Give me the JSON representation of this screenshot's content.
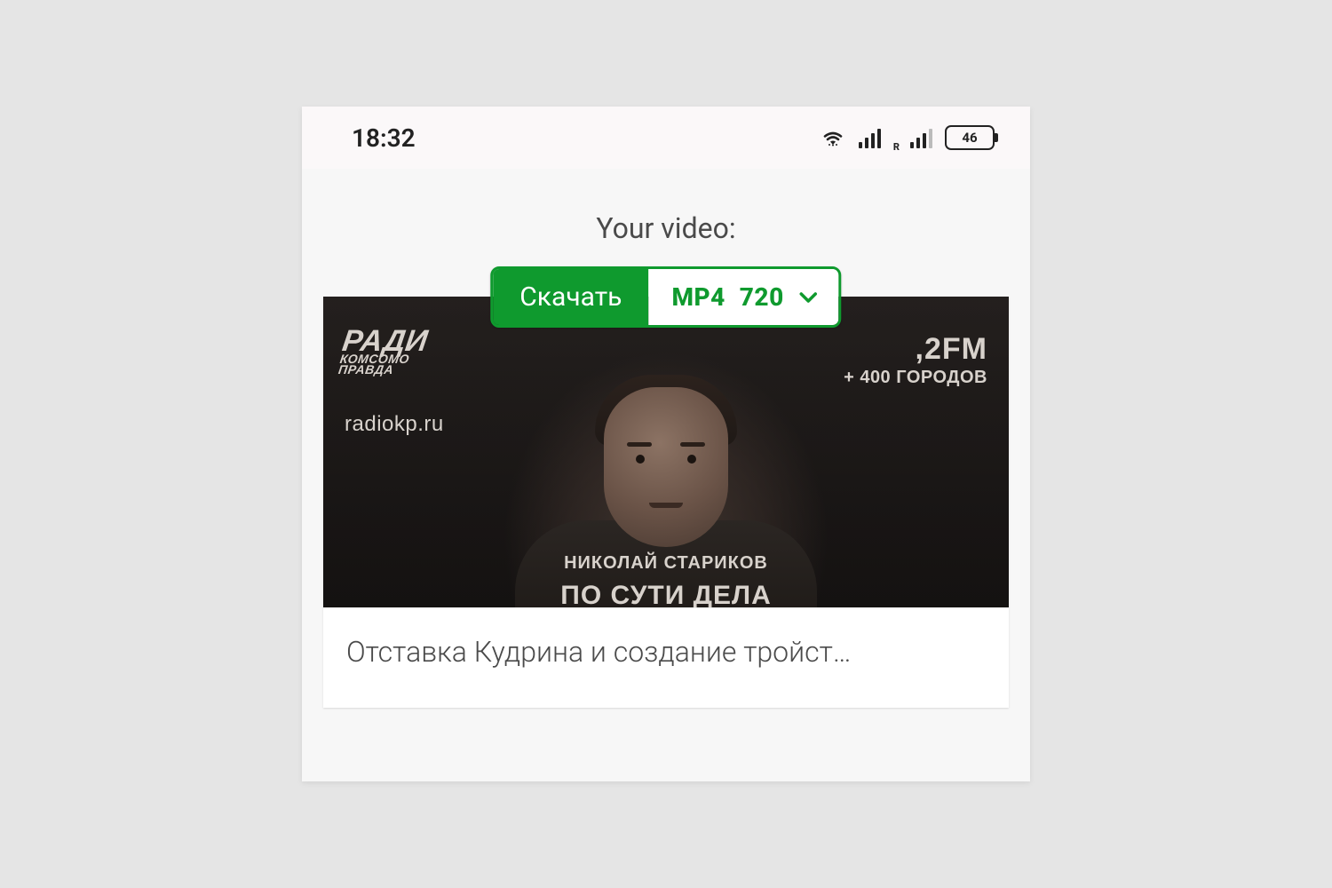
{
  "status": {
    "time": "18:32",
    "battery_pct": "46"
  },
  "heading": "Your video:",
  "download": {
    "button_label": "Скачать",
    "format": "MP4",
    "quality": "720"
  },
  "thumb": {
    "brand_line1": "РАДИ",
    "brand_line2": "КОМСОМО",
    "brand_line3": "ПРАВДА",
    "url": "radiokp.ru",
    "fm_right": ",2FM",
    "fm_sub": "+ 400 ГОРОДОВ",
    "person_name": "НИКОЛАЙ СТАРИКОВ",
    "program_caption": "ПО СУТИ ДЕЛА"
  },
  "video_title": "Отставка Кудрина и создание тройст…",
  "colors": {
    "accent": "#0f9a2e"
  }
}
